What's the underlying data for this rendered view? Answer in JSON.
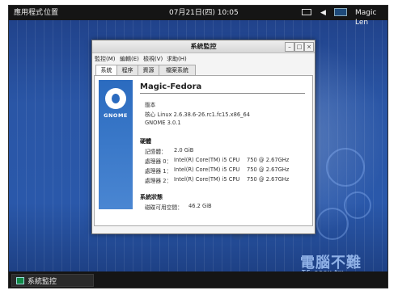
{
  "topbar": {
    "applications": "應用程式",
    "places": "位置",
    "datetime": "07月21日(四) 10:05",
    "user": "Magic Len"
  },
  "taskbar": {
    "item": "系統監控"
  },
  "window": {
    "title": "系統監控",
    "menus": [
      "監控(M)",
      "編輯(E)",
      "檢視(V)",
      "求助(H)"
    ],
    "tabs": [
      "系統",
      "程序",
      "資源",
      "檔案系統"
    ],
    "active_tab": "系統",
    "hostname": "Magic-Fedora",
    "logo_text": "GNOME",
    "version_section": "版本",
    "kernel": "核心 Linux 2.6.38.6-26.rc1.fc15.x86_64",
    "gnome_version": "GNOME 3.0.1",
    "hardware_section": "硬體",
    "memory_label": "記憶體：",
    "memory_value": "2.0 GiB",
    "cpus": [
      {
        "label": "處理器 0：",
        "value": "Intel(R) Core(TM) i5 CPU",
        "speed": "750  @ 2.67GHz"
      },
      {
        "label": "處理器 1：",
        "value": "Intel(R) Core(TM) i5 CPU",
        "speed": "750  @ 2.67GHz"
      },
      {
        "label": "處理器 2：",
        "value": "Intel(R) Core(TM) i5 CPU",
        "speed": "750  @ 2.67GHz"
      }
    ],
    "status_section": "系統狀態",
    "disk_label": "磁碟可用空間：",
    "disk_value": "46.2 GiB"
  },
  "watermark": {
    "main": "電腦不難",
    "sub": "TE-easy.tw"
  },
  "colors": {
    "desktop": "#2a56a6",
    "panel": "#151515"
  }
}
